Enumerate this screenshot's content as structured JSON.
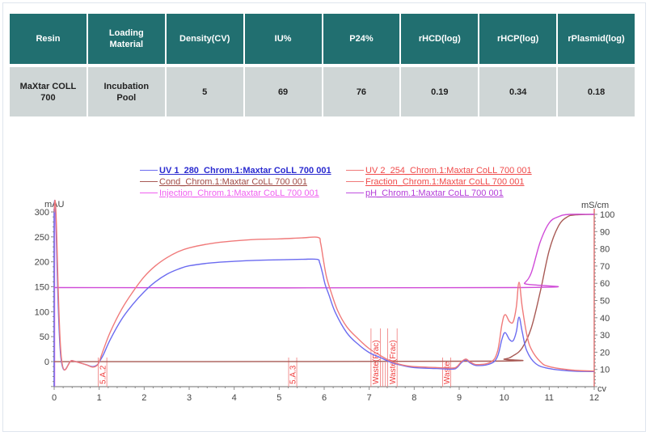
{
  "table": {
    "headers": [
      "Resin",
      "Loading Material",
      "Density(CV)",
      "IU%",
      "P24%",
      "rHCD(log)",
      "rHCP(log)",
      "rPlasmid(log)"
    ],
    "rows": [
      [
        "MaXtar COLL 700",
        "Incubation Pool",
        "5",
        "69",
        "76",
        "0.19",
        "0.34",
        "0.18"
      ]
    ],
    "colors": {
      "header_bg": "#216f70",
      "header_text": "#ffffff",
      "cell_bg": "#cfd6d6"
    }
  },
  "chart_data": {
    "type": "line",
    "title": "",
    "x_axis": {
      "label": "cv",
      "range": [
        0,
        12
      ],
      "ticks": [
        "0",
        "1",
        "2",
        "3",
        "4",
        "5",
        "6",
        "7",
        "8",
        "9",
        "10",
        "11",
        "12"
      ]
    },
    "y_left": {
      "label": "mAU",
      "range": [
        -50,
        300
      ],
      "ticks": [
        "0",
        "50",
        "100",
        "150",
        "200",
        "250",
        "300"
      ]
    },
    "y_right": {
      "label": "mS/cm",
      "range": [
        0,
        100
      ],
      "ticks": [
        "10",
        "20",
        "30",
        "40",
        "50",
        "60",
        "70",
        "80",
        "90",
        "100"
      ]
    },
    "grid": false,
    "legend_position": "top",
    "legend": [
      {
        "label": "UV 1_280_Chrom.1:Maxtar CoLL 700 001",
        "color": "#2b2bd0",
        "bold": true
      },
      {
        "label": "UV 2_254_Chrom.1:Maxtar CoLL 700 001",
        "color": "#f04a4a",
        "bold": false
      },
      {
        "label": "Cond_Chrom.1:Maxtar CoLL 700 001",
        "color": "#a04a45",
        "bold": false
      },
      {
        "label": "Fraction_Chrom.1:Maxtar CoLL 700 001",
        "color": "#f04a4a",
        "bold": false
      },
      {
        "label": "Injection_Chrom.1:Maxtar CoLL 700 001",
        "color": "#f060f0",
        "bold": false
      },
      {
        "label": "pH_Chrom.1:Maxtar CoLL 700 001",
        "color": "#b43cd8",
        "bold": false
      }
    ],
    "series": [
      {
        "name": "UV 1_280",
        "axis": "left",
        "color": "#6b6bf0",
        "points": [
          [
            0,
            300
          ],
          [
            0.03,
            300
          ],
          [
            0.15,
            8
          ],
          [
            0.4,
            2
          ],
          [
            0.7,
            -6
          ],
          [
            0.85,
            -10
          ],
          [
            0.95,
            -7
          ],
          [
            1.0,
            -1
          ],
          [
            1.1,
            15
          ],
          [
            1.25,
            45
          ],
          [
            1.5,
            85
          ],
          [
            1.75,
            115
          ],
          [
            2.0,
            140
          ],
          [
            2.25,
            160
          ],
          [
            2.5,
            175
          ],
          [
            2.75,
            185
          ],
          [
            3.0,
            192
          ],
          [
            3.5,
            198
          ],
          [
            4.0,
            201
          ],
          [
            4.5,
            203
          ],
          [
            5.0,
            204
          ],
          [
            5.5,
            205
          ],
          [
            5.84,
            205
          ],
          [
            5.9,
            198
          ],
          [
            5.96,
            178
          ],
          [
            6.02,
            155
          ],
          [
            6.1,
            135
          ],
          [
            6.25,
            98
          ],
          [
            6.5,
            58
          ],
          [
            6.75,
            35
          ],
          [
            7.0,
            18
          ],
          [
            7.25,
            8
          ],
          [
            7.5,
            -2
          ],
          [
            7.75,
            -8
          ],
          [
            8.0,
            -12
          ],
          [
            8.5,
            -14
          ],
          [
            8.85,
            -15
          ],
          [
            8.95,
            -12
          ],
          [
            9.05,
            -2
          ],
          [
            9.15,
            3
          ],
          [
            9.25,
            -3
          ],
          [
            9.4,
            -8
          ],
          [
            9.7,
            -4
          ],
          [
            9.85,
            10
          ],
          [
            9.95,
            45
          ],
          [
            10.02,
            58
          ],
          [
            10.12,
            44
          ],
          [
            10.2,
            42
          ],
          [
            10.27,
            60
          ],
          [
            10.33,
            89
          ],
          [
            10.4,
            60
          ],
          [
            10.5,
            22
          ],
          [
            10.7,
            -4
          ],
          [
            11.0,
            -14
          ],
          [
            11.5,
            -19
          ],
          [
            12,
            -20
          ]
        ]
      },
      {
        "name": "UV 2_254",
        "axis": "left",
        "color": "#f07a7a",
        "points": [
          [
            0,
            300
          ],
          [
            0.04,
            300
          ],
          [
            0.16,
            8
          ],
          [
            0.4,
            2
          ],
          [
            0.7,
            -6
          ],
          [
            0.85,
            -11
          ],
          [
            0.95,
            -8
          ],
          [
            1.0,
            0
          ],
          [
            1.1,
            25
          ],
          [
            1.25,
            60
          ],
          [
            1.5,
            105
          ],
          [
            1.75,
            140
          ],
          [
            2.0,
            170
          ],
          [
            2.25,
            192
          ],
          [
            2.5,
            208
          ],
          [
            2.75,
            220
          ],
          [
            3.0,
            228
          ],
          [
            3.5,
            237
          ],
          [
            4.0,
            242
          ],
          [
            4.5,
            245
          ],
          [
            5.0,
            246
          ],
          [
            5.5,
            248
          ],
          [
            5.86,
            249
          ],
          [
            5.92,
            238
          ],
          [
            5.98,
            205
          ],
          [
            6.05,
            170
          ],
          [
            6.15,
            140
          ],
          [
            6.3,
            102
          ],
          [
            6.5,
            70
          ],
          [
            6.75,
            46
          ],
          [
            7.0,
            26
          ],
          [
            7.25,
            12
          ],
          [
            7.5,
            0
          ],
          [
            7.75,
            -7
          ],
          [
            8.0,
            -10
          ],
          [
            8.5,
            -12
          ],
          [
            8.85,
            -13
          ],
          [
            8.95,
            -10
          ],
          [
            9.05,
            0
          ],
          [
            9.15,
            5
          ],
          [
            9.25,
            -1
          ],
          [
            9.4,
            -6
          ],
          [
            9.7,
            -1
          ],
          [
            9.85,
            20
          ],
          [
            9.95,
            75
          ],
          [
            10.02,
            94
          ],
          [
            10.12,
            80
          ],
          [
            10.2,
            80
          ],
          [
            10.27,
            110
          ],
          [
            10.33,
            159
          ],
          [
            10.4,
            110
          ],
          [
            10.5,
            55
          ],
          [
            10.6,
            25
          ],
          [
            10.8,
            0
          ],
          [
            11.0,
            -10
          ],
          [
            11.5,
            -17
          ],
          [
            12,
            -19
          ]
        ]
      },
      {
        "name": "Cond",
        "axis": "right",
        "color": "#a85a55",
        "points": [
          [
            0,
            14.5
          ],
          [
            9.5,
            14.8
          ],
          [
            10.0,
            16
          ],
          [
            10.2,
            18
          ],
          [
            10.4,
            22.5
          ],
          [
            10.6,
            34
          ],
          [
            10.8,
            55
          ],
          [
            11.0,
            79
          ],
          [
            11.2,
            93
          ],
          [
            11.4,
            98.5
          ],
          [
            11.6,
            99.7
          ],
          [
            12,
            100
          ]
        ]
      },
      {
        "name": "pH",
        "axis": "right",
        "color": "#d04cd8",
        "points": [
          [
            0,
            57.5
          ],
          [
            10.35,
            57.5
          ],
          [
            10.45,
            60
          ],
          [
            10.6,
            66
          ],
          [
            10.8,
            84
          ],
          [
            11.0,
            95
          ],
          [
            11.2,
            98.6
          ],
          [
            11.45,
            100
          ],
          [
            12,
            100
          ]
        ]
      }
    ],
    "fraction_marks": [
      {
        "cv": 0.98,
        "end_cv": 1.17,
        "label": "5.A.2"
      },
      {
        "cv": 5.21,
        "end_cv": 5.39,
        "label": "5.A.3"
      },
      {
        "cv": 7.04,
        "end_cv": 7.25,
        "label": "Waste(Frac)"
      },
      {
        "cv": 7.3,
        "end_cv": 7.36,
        "label": ""
      },
      {
        "cv": 7.41,
        "end_cv": 7.62,
        "label": "Waste(Frac)"
      },
      {
        "cv": 8.63,
        "end_cv": 8.81,
        "label": "Waste"
      }
    ],
    "injection_marks": [
      0
    ]
  }
}
